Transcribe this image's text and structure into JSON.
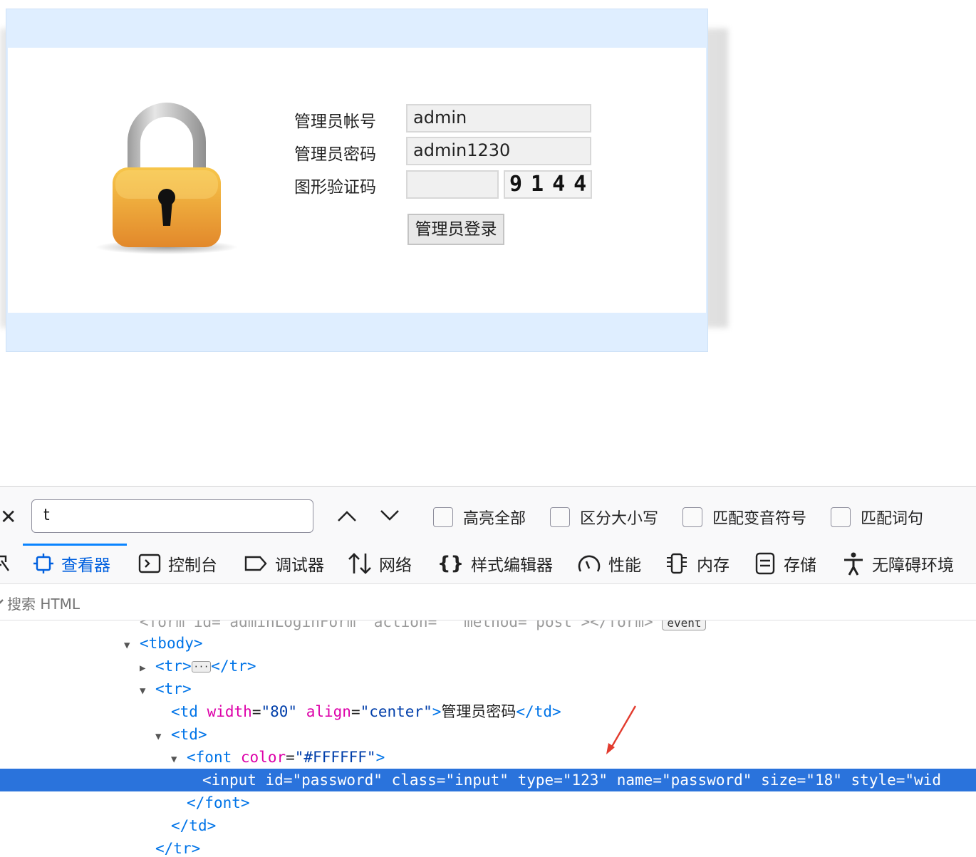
{
  "login": {
    "account_label": "管理员帐号",
    "account_value": "admin",
    "password_label": "管理员密码",
    "password_value": "admin1230",
    "captcha_label": "图形验证码",
    "captcha_input_value": "",
    "captcha_image_text": "9144",
    "submit_label": "管理员登录"
  },
  "devtools": {
    "find": {
      "query": "t",
      "options": [
        "高亮全部",
        "区分大小写",
        "匹配变音符号",
        "匹配词句"
      ]
    },
    "tabs": [
      "查看器",
      "控制台",
      "调试器",
      "网络",
      "样式编辑器",
      "性能",
      "内存",
      "存储",
      "无障碍环境"
    ],
    "search_placeholder": "搜索 HTML",
    "tree": {
      "form_line": "<form id=\"adminLoginForm\" action=\"\" method=\"post\"></form>",
      "event_badge": "event",
      "tbody": "tbody",
      "tr": "tr",
      "td": "td",
      "font": "font",
      "td_text": "管理员密码",
      "attr_width": "width",
      "val_width": "\"80\"",
      "attr_align": "align",
      "val_align": "\"center\"",
      "attr_color": "color",
      "val_color": "\"#FFFFFF\"",
      "input_tag": "input",
      "input_attrs": [
        {
          "name": "id",
          "value": "\"password\""
        },
        {
          "name": "class",
          "value": "\"input\""
        },
        {
          "name": "type",
          "value": "\"123\""
        },
        {
          "name": "name",
          "value": "\"password\""
        },
        {
          "name": "size",
          "value": "\"18\""
        },
        {
          "name": "style",
          "value": "\"wid"
        }
      ]
    }
  }
}
